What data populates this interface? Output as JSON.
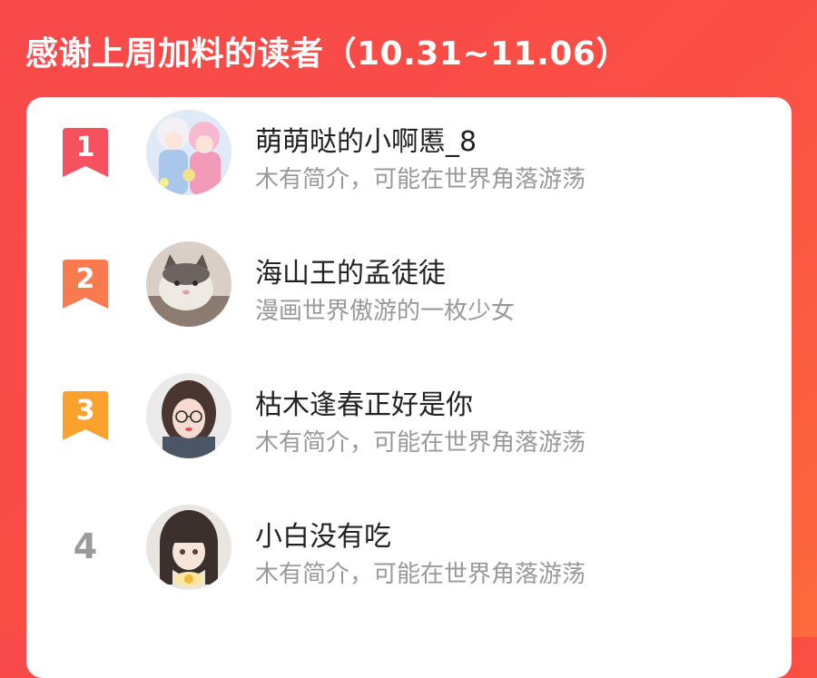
{
  "header": {
    "title": "感谢上周加料的读者（10.31~11.06）"
  },
  "readers": [
    {
      "rank": "1",
      "name": "萌萌哒的小啊慝_8",
      "bio": "木有简介，可能在世界角落游荡",
      "badge_color": "#f5515f",
      "avatar": "anime-couple-avatar"
    },
    {
      "rank": "2",
      "name": "海山王的孟徒徒",
      "bio": "漫画世界傲游的一枚少女",
      "badge_color": "#fa7a50",
      "avatar": "cat-photo-avatar"
    },
    {
      "rank": "3",
      "name": "枯木逢春正好是你",
      "bio": "木有简介，可能在世界角落游荡",
      "badge_color": "#fba22e",
      "avatar": "girl-with-glasses-avatar"
    },
    {
      "rank": "4",
      "name": "小白没有吃",
      "bio": "木有简介，可能在世界角落游荡",
      "avatar": "anime-girl-avatar"
    }
  ]
}
